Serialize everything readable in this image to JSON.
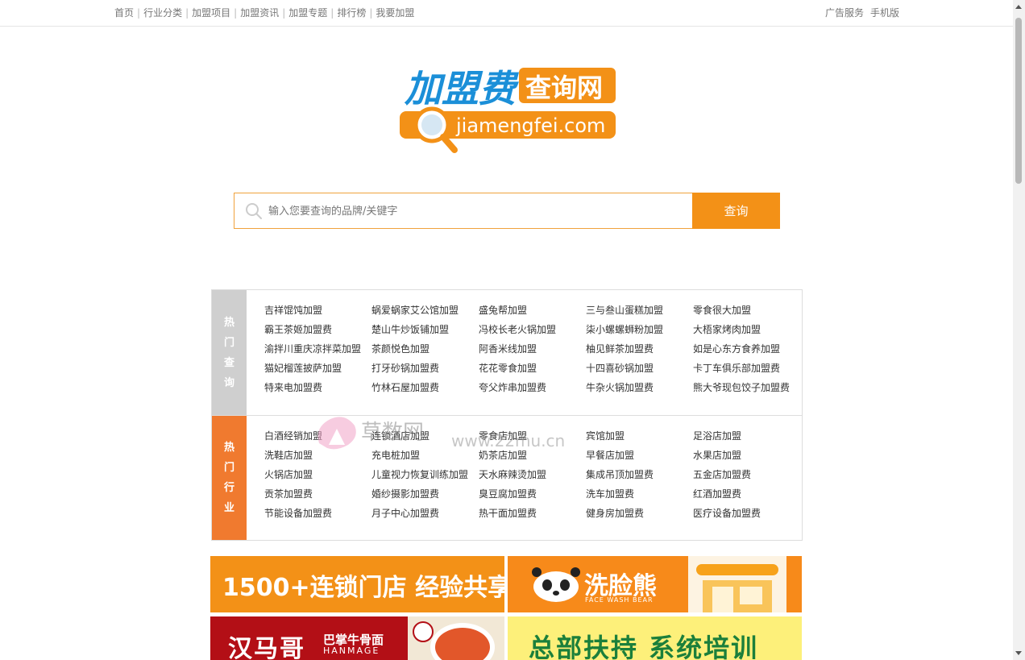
{
  "topnav": {
    "items": [
      "首页",
      "行业分类",
      "加盟项目",
      "加盟资讯",
      "加盟专题",
      "排行榜",
      "我要加盟"
    ],
    "right": [
      "广告服务",
      "手机版"
    ]
  },
  "logo": {
    "title": "加盟费",
    "badge": "查询网",
    "domain": "jiamengfei.com"
  },
  "search": {
    "placeholder": "输入您要查询的品牌/关键字",
    "button": "查询"
  },
  "hot_query": {
    "label": [
      "热",
      "门",
      "查",
      "询"
    ],
    "items": [
      "吉祥馄饨加盟",
      "蜗爱蜗家艾公馆加盟",
      "盛兔帮加盟",
      "三与叁山蛋糕加盟",
      "零食很大加盟",
      "霸王茶姬加盟费",
      "楚山牛炒饭铺加盟",
      "冯校长老火锅加盟",
      "柒小螺螺蛳粉加盟",
      "大梧家烤肉加盟",
      "渝拌川重庆凉拌菜加盟",
      "茶颜悦色加盟",
      "阿香米线加盟",
      "柚见鲜茶加盟费",
      "如是心东方食养加盟",
      "猫妃榴莲披萨加盟",
      "打牙砂锅加盟费",
      "花花零食加盟",
      "十四喜砂锅加盟",
      "卡丁车俱乐部加盟费",
      "特来电加盟费",
      "竹林石屋加盟费",
      "夸父炸串加盟费",
      "牛杂火锅加盟费",
      "熊大爷现包饺子加盟费"
    ]
  },
  "hot_industry": {
    "label": [
      "热",
      "门",
      "行",
      "业"
    ],
    "items": [
      "白酒经销加盟",
      "连锁酒店加盟",
      "零食店加盟",
      "宾馆加盟",
      "足浴店加盟",
      "洗鞋店加盟",
      "充电桩加盟",
      "奶茶店加盟",
      "早餐店加盟",
      "水果店加盟",
      "火锅店加盟",
      "儿童视力恢复训练加盟",
      "天水麻辣烫加盟",
      "集成吊顶加盟费",
      "五金店加盟费",
      "贡茶加盟费",
      "婚纱摄影加盟费",
      "臭豆腐加盟费",
      "洗车加盟费",
      "红酒加盟费",
      "节能设备加盟费",
      "月子中心加盟费",
      "热干面加盟费",
      "健身房加盟费",
      "医疗设备加盟费"
    ]
  },
  "watermark": {
    "text": "草数网",
    "url": "www.22mu.cn"
  },
  "banners": {
    "b1": "1500+连锁门店 经验共享",
    "b2_brand": "洗脸熊",
    "b2_sub": "FACE WASH BEAR",
    "b3_brand": "汉马哥",
    "b3_sub1": "巴掌牛骨面",
    "b3_sub2": "HANMAGE",
    "b4": "总部扶持 系统培训"
  },
  "colors": {
    "accent": "#f39117",
    "industry_label": "#f07a2f",
    "query_label": "#cfcfcf"
  }
}
